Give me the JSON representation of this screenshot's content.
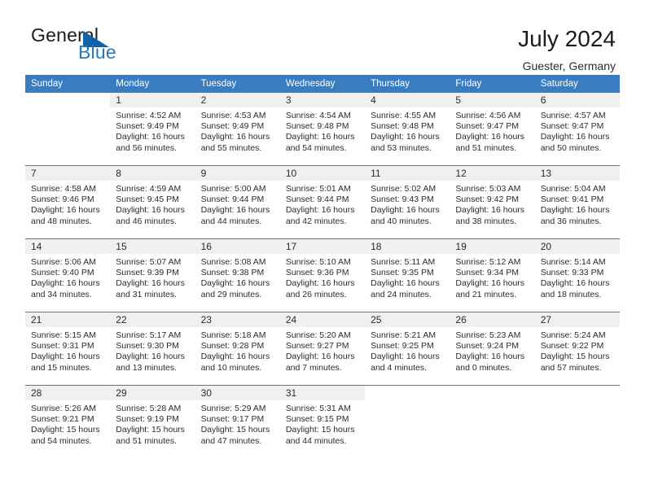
{
  "brand": {
    "name_part1": "General",
    "name_part2": "Blue",
    "triangle_icon": "triangle-logo-icon",
    "accent_color": "#2079c4",
    "triangle_color": "#1162ab"
  },
  "header": {
    "title": "July 2024",
    "location": "Guester, Germany"
  },
  "calendar": {
    "header_bg": "#3a7cc0",
    "daynum_bg": "#f0f0f0",
    "weekday_headers": [
      "Sunday",
      "Monday",
      "Tuesday",
      "Wednesday",
      "Thursday",
      "Friday",
      "Saturday"
    ],
    "weeks": [
      [
        {
          "day": "",
          "sunrise": "",
          "sunset": "",
          "daylight_line1": "",
          "daylight_line2": ""
        },
        {
          "day": "1",
          "sunrise": "Sunrise: 4:52 AM",
          "sunset": "Sunset: 9:49 PM",
          "daylight_line1": "Daylight: 16 hours",
          "daylight_line2": "and 56 minutes."
        },
        {
          "day": "2",
          "sunrise": "Sunrise: 4:53 AM",
          "sunset": "Sunset: 9:49 PM",
          "daylight_line1": "Daylight: 16 hours",
          "daylight_line2": "and 55 minutes."
        },
        {
          "day": "3",
          "sunrise": "Sunrise: 4:54 AM",
          "sunset": "Sunset: 9:48 PM",
          "daylight_line1": "Daylight: 16 hours",
          "daylight_line2": "and 54 minutes."
        },
        {
          "day": "4",
          "sunrise": "Sunrise: 4:55 AM",
          "sunset": "Sunset: 9:48 PM",
          "daylight_line1": "Daylight: 16 hours",
          "daylight_line2": "and 53 minutes."
        },
        {
          "day": "5",
          "sunrise": "Sunrise: 4:56 AM",
          "sunset": "Sunset: 9:47 PM",
          "daylight_line1": "Daylight: 16 hours",
          "daylight_line2": "and 51 minutes."
        },
        {
          "day": "6",
          "sunrise": "Sunrise: 4:57 AM",
          "sunset": "Sunset: 9:47 PM",
          "daylight_line1": "Daylight: 16 hours",
          "daylight_line2": "and 50 minutes."
        }
      ],
      [
        {
          "day": "7",
          "sunrise": "Sunrise: 4:58 AM",
          "sunset": "Sunset: 9:46 PM",
          "daylight_line1": "Daylight: 16 hours",
          "daylight_line2": "and 48 minutes."
        },
        {
          "day": "8",
          "sunrise": "Sunrise: 4:59 AM",
          "sunset": "Sunset: 9:45 PM",
          "daylight_line1": "Daylight: 16 hours",
          "daylight_line2": "and 46 minutes."
        },
        {
          "day": "9",
          "sunrise": "Sunrise: 5:00 AM",
          "sunset": "Sunset: 9:44 PM",
          "daylight_line1": "Daylight: 16 hours",
          "daylight_line2": "and 44 minutes."
        },
        {
          "day": "10",
          "sunrise": "Sunrise: 5:01 AM",
          "sunset": "Sunset: 9:44 PM",
          "daylight_line1": "Daylight: 16 hours",
          "daylight_line2": "and 42 minutes."
        },
        {
          "day": "11",
          "sunrise": "Sunrise: 5:02 AM",
          "sunset": "Sunset: 9:43 PM",
          "daylight_line1": "Daylight: 16 hours",
          "daylight_line2": "and 40 minutes."
        },
        {
          "day": "12",
          "sunrise": "Sunrise: 5:03 AM",
          "sunset": "Sunset: 9:42 PM",
          "daylight_line1": "Daylight: 16 hours",
          "daylight_line2": "and 38 minutes."
        },
        {
          "day": "13",
          "sunrise": "Sunrise: 5:04 AM",
          "sunset": "Sunset: 9:41 PM",
          "daylight_line1": "Daylight: 16 hours",
          "daylight_line2": "and 36 minutes."
        }
      ],
      [
        {
          "day": "14",
          "sunrise": "Sunrise: 5:06 AM",
          "sunset": "Sunset: 9:40 PM",
          "daylight_line1": "Daylight: 16 hours",
          "daylight_line2": "and 34 minutes."
        },
        {
          "day": "15",
          "sunrise": "Sunrise: 5:07 AM",
          "sunset": "Sunset: 9:39 PM",
          "daylight_line1": "Daylight: 16 hours",
          "daylight_line2": "and 31 minutes."
        },
        {
          "day": "16",
          "sunrise": "Sunrise: 5:08 AM",
          "sunset": "Sunset: 9:38 PM",
          "daylight_line1": "Daylight: 16 hours",
          "daylight_line2": "and 29 minutes."
        },
        {
          "day": "17",
          "sunrise": "Sunrise: 5:10 AM",
          "sunset": "Sunset: 9:36 PM",
          "daylight_line1": "Daylight: 16 hours",
          "daylight_line2": "and 26 minutes."
        },
        {
          "day": "18",
          "sunrise": "Sunrise: 5:11 AM",
          "sunset": "Sunset: 9:35 PM",
          "daylight_line1": "Daylight: 16 hours",
          "daylight_line2": "and 24 minutes."
        },
        {
          "day": "19",
          "sunrise": "Sunrise: 5:12 AM",
          "sunset": "Sunset: 9:34 PM",
          "daylight_line1": "Daylight: 16 hours",
          "daylight_line2": "and 21 minutes."
        },
        {
          "day": "20",
          "sunrise": "Sunrise: 5:14 AM",
          "sunset": "Sunset: 9:33 PM",
          "daylight_line1": "Daylight: 16 hours",
          "daylight_line2": "and 18 minutes."
        }
      ],
      [
        {
          "day": "21",
          "sunrise": "Sunrise: 5:15 AM",
          "sunset": "Sunset: 9:31 PM",
          "daylight_line1": "Daylight: 16 hours",
          "daylight_line2": "and 15 minutes."
        },
        {
          "day": "22",
          "sunrise": "Sunrise: 5:17 AM",
          "sunset": "Sunset: 9:30 PM",
          "daylight_line1": "Daylight: 16 hours",
          "daylight_line2": "and 13 minutes."
        },
        {
          "day": "23",
          "sunrise": "Sunrise: 5:18 AM",
          "sunset": "Sunset: 9:28 PM",
          "daylight_line1": "Daylight: 16 hours",
          "daylight_line2": "and 10 minutes."
        },
        {
          "day": "24",
          "sunrise": "Sunrise: 5:20 AM",
          "sunset": "Sunset: 9:27 PM",
          "daylight_line1": "Daylight: 16 hours",
          "daylight_line2": "and 7 minutes."
        },
        {
          "day": "25",
          "sunrise": "Sunrise: 5:21 AM",
          "sunset": "Sunset: 9:25 PM",
          "daylight_line1": "Daylight: 16 hours",
          "daylight_line2": "and 4 minutes."
        },
        {
          "day": "26",
          "sunrise": "Sunrise: 5:23 AM",
          "sunset": "Sunset: 9:24 PM",
          "daylight_line1": "Daylight: 16 hours",
          "daylight_line2": "and 0 minutes."
        },
        {
          "day": "27",
          "sunrise": "Sunrise: 5:24 AM",
          "sunset": "Sunset: 9:22 PM",
          "daylight_line1": "Daylight: 15 hours",
          "daylight_line2": "and 57 minutes."
        }
      ],
      [
        {
          "day": "28",
          "sunrise": "Sunrise: 5:26 AM",
          "sunset": "Sunset: 9:21 PM",
          "daylight_line1": "Daylight: 15 hours",
          "daylight_line2": "and 54 minutes."
        },
        {
          "day": "29",
          "sunrise": "Sunrise: 5:28 AM",
          "sunset": "Sunset: 9:19 PM",
          "daylight_line1": "Daylight: 15 hours",
          "daylight_line2": "and 51 minutes."
        },
        {
          "day": "30",
          "sunrise": "Sunrise: 5:29 AM",
          "sunset": "Sunset: 9:17 PM",
          "daylight_line1": "Daylight: 15 hours",
          "daylight_line2": "and 47 minutes."
        },
        {
          "day": "31",
          "sunrise": "Sunrise: 5:31 AM",
          "sunset": "Sunset: 9:15 PM",
          "daylight_line1": "Daylight: 15 hours",
          "daylight_line2": "and 44 minutes."
        },
        {
          "day": "",
          "sunrise": "",
          "sunset": "",
          "daylight_line1": "",
          "daylight_line2": ""
        },
        {
          "day": "",
          "sunrise": "",
          "sunset": "",
          "daylight_line1": "",
          "daylight_line2": ""
        },
        {
          "day": "",
          "sunrise": "",
          "sunset": "",
          "daylight_line1": "",
          "daylight_line2": ""
        }
      ]
    ]
  }
}
